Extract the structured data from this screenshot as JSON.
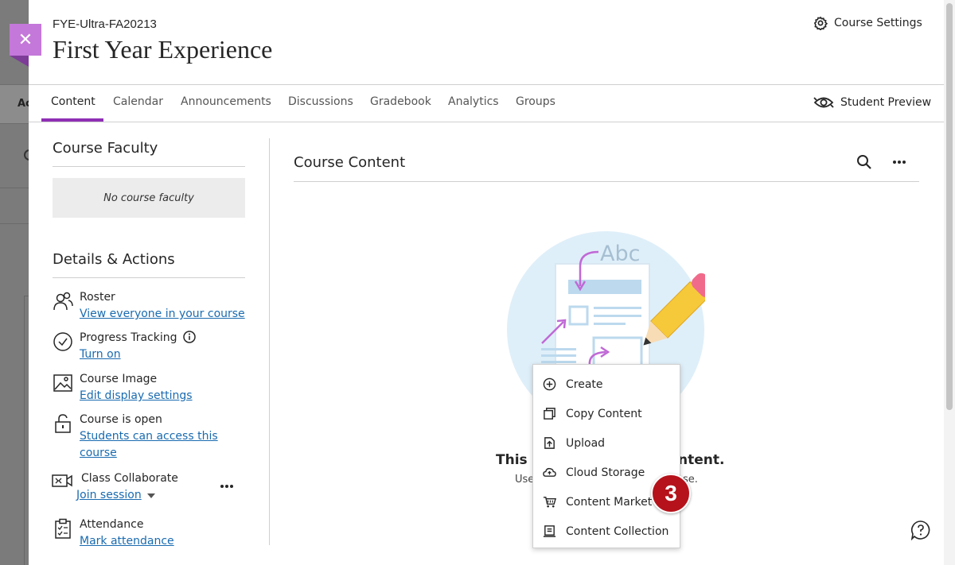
{
  "background": {
    "tab_abbrev": "Ac"
  },
  "close_button": {
    "symbol": "✕"
  },
  "header": {
    "course_code": "FYE-Ultra-FA20213",
    "course_title": "First Year Experience",
    "settings_label": "Course Settings"
  },
  "nav": {
    "tabs": [
      {
        "label": "Content",
        "active": true
      },
      {
        "label": "Calendar"
      },
      {
        "label": "Announcements"
      },
      {
        "label": "Discussions"
      },
      {
        "label": "Gradebook"
      },
      {
        "label": "Analytics"
      },
      {
        "label": "Groups"
      }
    ],
    "student_preview": "Student Preview"
  },
  "sidebar": {
    "faculty_title": "Course Faculty",
    "no_faculty": "No course faculty",
    "details_title": "Details & Actions",
    "items": [
      {
        "icon": "roster-icon",
        "label": "Roster",
        "link": "View everyone in your course"
      },
      {
        "icon": "progress-check-icon",
        "label": "Progress Tracking",
        "link": "Turn on"
      },
      {
        "icon": "image-icon",
        "label": "Course Image",
        "link": "Edit display settings"
      },
      {
        "icon": "unlock-icon",
        "label": "Course is open",
        "link1": "Students can access this",
        "link2": "course"
      },
      {
        "icon": "collaborate-icon",
        "label": "Class Collaborate",
        "link": "Join session"
      },
      {
        "icon": "attendance-icon",
        "label": "Attendance",
        "link": "Mark attendance"
      }
    ]
  },
  "content": {
    "title": "Course Content",
    "illustration_text": "Abc",
    "empty_title_left": "This c",
    "empty_title_right": "ntent.",
    "empty_sub_left": "Use",
    "empty_sub_right": "se."
  },
  "menu": {
    "items": [
      {
        "icon": "plus-circle-icon",
        "label": "Create"
      },
      {
        "icon": "copy-icon",
        "label": "Copy Content"
      },
      {
        "icon": "upload-icon",
        "label": "Upload"
      },
      {
        "icon": "cloud-storage-icon",
        "label": "Cloud Storage"
      },
      {
        "icon": "market-cart-icon",
        "label": "Content Market"
      },
      {
        "icon": "collection-icon",
        "label": "Content Collection"
      }
    ]
  },
  "step_badge": "3",
  "colors": {
    "accent": "#8f2fb5",
    "close_tab": "#c478d9",
    "link": "#1a6bb0",
    "badge": "#b5121b"
  }
}
